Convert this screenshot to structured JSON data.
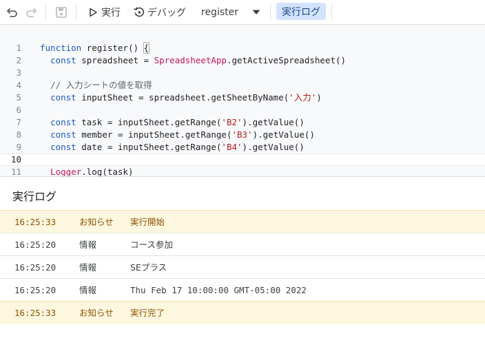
{
  "toolbar": {
    "undo_icon": "undo-icon",
    "redo_icon": "redo-icon",
    "save_icon": "save-icon",
    "run_label": "実行",
    "debug_label": "デバッグ",
    "function_name": "register",
    "log_label": "実行ログ"
  },
  "editor": {
    "lines": [
      {
        "num": "1",
        "tokens": [
          {
            "t": "function",
            "c": "kw"
          },
          {
            "t": " register() "
          },
          {
            "t": "{",
            "c": "brk"
          }
        ]
      },
      {
        "num": "2",
        "tokens": [
          {
            "t": "  "
          },
          {
            "t": "const",
            "c": "kw"
          },
          {
            "t": " spreadsheet = "
          },
          {
            "t": "SpreadsheetApp",
            "c": "cls"
          },
          {
            "t": ".getActiveSpreadsheet()"
          }
        ]
      },
      {
        "num": "3",
        "tokens": []
      },
      {
        "num": "4",
        "tokens": [
          {
            "t": "  // 入力シートの値を取得",
            "c": "cm"
          }
        ]
      },
      {
        "num": "5",
        "tokens": [
          {
            "t": "  "
          },
          {
            "t": "const",
            "c": "kw"
          },
          {
            "t": " inputSheet = spreadsheet.getSheetByName("
          },
          {
            "t": "'入力'",
            "c": "str"
          },
          {
            "t": ")"
          }
        ]
      },
      {
        "num": "6",
        "tokens": []
      },
      {
        "num": "7",
        "tokens": [
          {
            "t": "  "
          },
          {
            "t": "const",
            "c": "kw"
          },
          {
            "t": " task = inputSheet.getRange("
          },
          {
            "t": "'B2'",
            "c": "str"
          },
          {
            "t": ").getValue()"
          }
        ]
      },
      {
        "num": "8",
        "tokens": [
          {
            "t": "  "
          },
          {
            "t": "const",
            "c": "kw"
          },
          {
            "t": " member = inputSheet.getRange("
          },
          {
            "t": "'B3'",
            "c": "str"
          },
          {
            "t": ").getValue()"
          }
        ]
      },
      {
        "num": "9",
        "tokens": [
          {
            "t": "  "
          },
          {
            "t": "const",
            "c": "kw"
          },
          {
            "t": " date = inputSheet.getRange("
          },
          {
            "t": "'B4'",
            "c": "str"
          },
          {
            "t": ").getValue()"
          }
        ]
      },
      {
        "num": "10",
        "tokens": [],
        "active": true
      },
      {
        "num": "11",
        "tokens": [
          {
            "t": "  "
          },
          {
            "t": "Logger",
            "c": "cls"
          },
          {
            "t": ".log(task)"
          }
        ]
      }
    ]
  },
  "log": {
    "title": "実行ログ",
    "rows": [
      {
        "time": "16:25:33",
        "level": "お知らせ",
        "message": "実行開始",
        "notice": true
      },
      {
        "time": "16:25:20",
        "level": "情報",
        "message": "コース参加",
        "notice": false
      },
      {
        "time": "16:25:20",
        "level": "情報",
        "message": "SEプラス",
        "notice": false
      },
      {
        "time": "16:25:20",
        "level": "情報",
        "message": "Thu Feb 17 10:00:00 GMT-05:00 2022",
        "notice": false,
        "mono": true
      },
      {
        "time": "16:25:33",
        "level": "お知らせ",
        "message": "実行完了",
        "notice": true
      }
    ]
  }
}
